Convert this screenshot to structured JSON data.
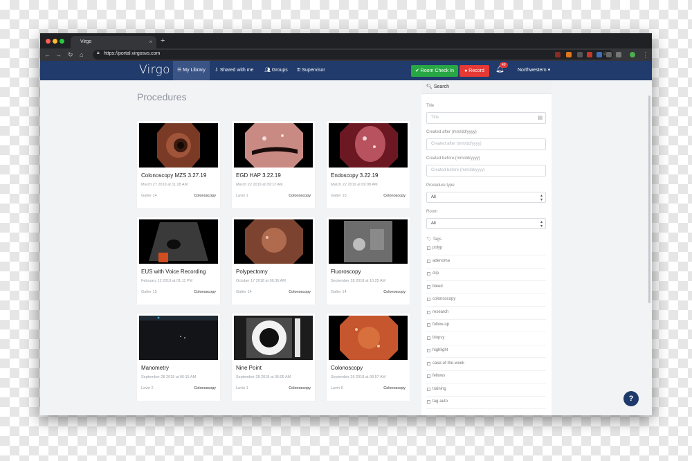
{
  "browser": {
    "tab_title": "Virgo",
    "tab_close": "×",
    "new_tab": "+",
    "url": "https://portal.virgosvs.com"
  },
  "app": {
    "logo": "Virgo",
    "nav": {
      "my_library": "My Library",
      "shared_with_me": "Shared with me",
      "groups": "Groups",
      "supervisor": "Supervisor"
    },
    "room_check_in": "Room Check In",
    "record": "Record",
    "notification_count": "49",
    "organization": "Northwestern",
    "colors": {
      "nav": "#203b6c",
      "green": "#28a745",
      "red": "#e53935"
    }
  },
  "main": {
    "title": "Procedures",
    "procedures": [
      {
        "title": "Colonoscopy MZS 3.27.19",
        "date": "March 27 2019 at 11:28 AM",
        "location": "Galter 14",
        "type": "Colonoscopy"
      },
      {
        "title": "EGD HAP 3.22.19",
        "date": "March 22 2019 at 09:12 AM",
        "location": "Lavin 1",
        "type": "Colonoscopy"
      },
      {
        "title": "Endoscopy 3.22.19",
        "date": "March 22 2019 at 09:08 AM",
        "location": "Galter 15",
        "type": "Colonoscopy"
      },
      {
        "title": "EUS with Voice Recording",
        "date": "February 12 2019 at 01:11 PM",
        "location": "Galter 15",
        "type": "Colonoscopy"
      },
      {
        "title": "Polypectomy",
        "date": "October 17 2018 at 06:36 AM",
        "location": "Galter 14",
        "type": "Colonoscopy"
      },
      {
        "title": "Fluoroscopy",
        "date": "September 28 2018 at 10:25 AM",
        "location": "Galter 14",
        "type": "Colonoscopy"
      },
      {
        "title": "Manometry",
        "date": "September 28 2018 at 06:15 AM",
        "location": "Lavin 2",
        "type": "Colonoscopy"
      },
      {
        "title": "Nine Point",
        "date": "September 28 2018 at 06:05 AM",
        "location": "Lavin 1",
        "type": "Colonoscopy"
      },
      {
        "title": "Colonoscopy",
        "date": "September 26 2018 at 08:57 AM",
        "location": "Lavin 5",
        "type": "Colonoscopy"
      }
    ]
  },
  "sidebar": {
    "search": "Search",
    "title_label": "Title",
    "title_placeholder": "Title",
    "created_after_label": "Created after (mm/dd/yyyy)",
    "created_after_placeholder": "Created after (mm/dd/yyyy)",
    "created_before_label": "Created before (mm/dd/yyyy)",
    "created_before_placeholder": "Created before (mm/dd/yyyy)",
    "procedure_type_label": "Procedure type",
    "procedure_type_value": "All",
    "room_label": "Room",
    "room_value": "All",
    "tags_label": "Tags",
    "tags": [
      "polyp",
      "adenoma",
      "clip",
      "bleed",
      "colonoscopy",
      "research",
      "follow-up",
      "biopsy",
      "highlight",
      "case-of-the-week",
      "fellows",
      "training",
      "tag-auto"
    ]
  },
  "help": "?"
}
